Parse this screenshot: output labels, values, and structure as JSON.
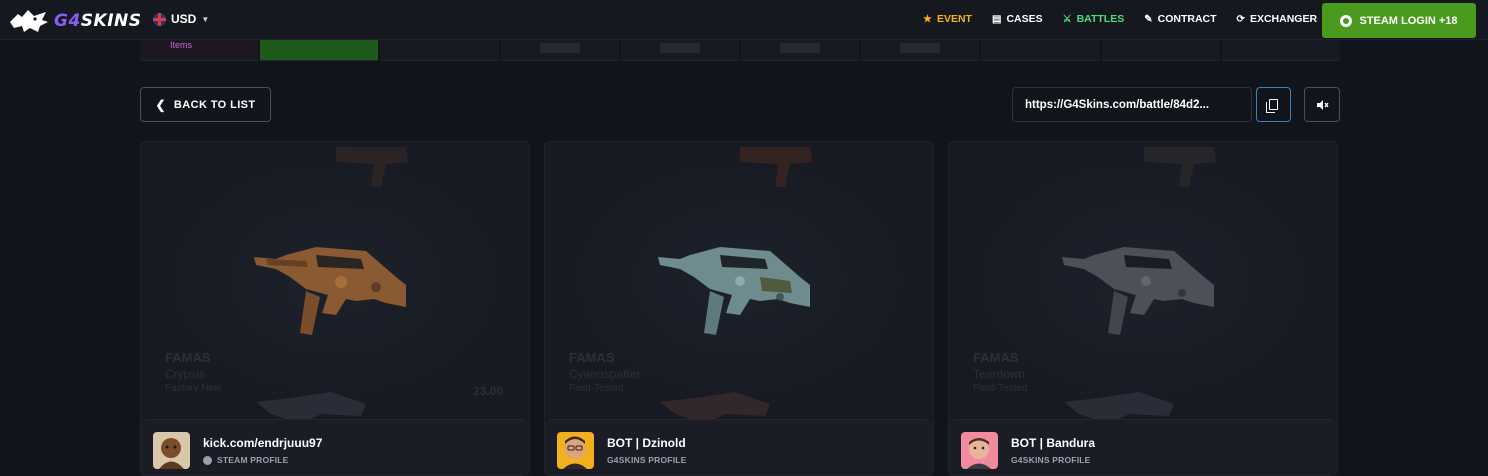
{
  "header": {
    "logo_prefix": "G4",
    "logo_suffix": "SKINS",
    "currency": "USD",
    "nav": [
      {
        "label": "EVENT",
        "icon": "star-icon"
      },
      {
        "label": "CASES",
        "icon": "cases-icon"
      },
      {
        "label": "BATTLES",
        "icon": "battles-icon"
      },
      {
        "label": "CONTRACT",
        "icon": "pen-icon"
      },
      {
        "label": "EXCHANGER",
        "icon": "exchange-icon"
      }
    ],
    "login_label": "STEAM LOGIN +18"
  },
  "strip": {
    "first_label": "Items"
  },
  "controls": {
    "back_label": "BACK TO LIST",
    "battle_url": "https://G4Skins.com/battle/84d2..."
  },
  "players": [
    {
      "name": "kick.com/endrjuuu97",
      "profile_label": "STEAM PROFILE",
      "weapon_name": "FAMAS",
      "skin_name": "Crypsis",
      "exterior": "Factory New",
      "price": "23.00"
    },
    {
      "name": "BOT | Dzinold",
      "profile_label": "G4SKINS PROFILE",
      "weapon_name": "FAMAS",
      "skin_name": "Cyanospatter",
      "exterior": "Field-Tested",
      "price": ""
    },
    {
      "name": "BOT | Bandura",
      "profile_label": "G4SKINS PROFILE",
      "weapon_name": "FAMAS",
      "skin_name": "Teardown",
      "exterior": "Field-Tested",
      "price": ""
    }
  ],
  "colors": {
    "accent_purple": "#8b5cf6",
    "event_gold": "#f5b417",
    "battles_green": "#4ade80",
    "steam_green": "#4a9a1e",
    "copy_blue": "#3b82c4"
  }
}
